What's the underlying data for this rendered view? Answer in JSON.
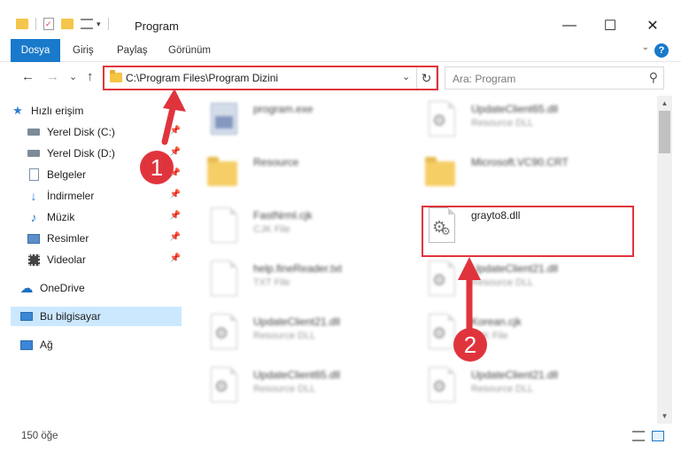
{
  "window": {
    "title": "Program",
    "minimize_glyph": "—",
    "maximize_glyph": "☐",
    "close_glyph": "✕"
  },
  "ribbon": {
    "tabs": [
      "Dosya",
      "Giriş",
      "Paylaş",
      "Görünüm"
    ],
    "help_glyph": "?",
    "collapse_glyph": "⌄"
  },
  "navigation": {
    "back_glyph": "←",
    "forward_glyph": "→",
    "recent_glyph": "⌄",
    "up_glyph": "↑",
    "address": "C:\\Program Files\\Program Dizini",
    "address_dropdown_glyph": "⌄",
    "refresh_glyph": "↻",
    "search_placeholder": "Ara: Program",
    "search_icon_glyph": "⚲"
  },
  "sidebar": {
    "quick_access": "Hızlı erişim",
    "items": [
      {
        "label": "Yerel Disk (C:)",
        "icon": "drive-icon",
        "pinned": true
      },
      {
        "label": "Yerel Disk (D:)",
        "icon": "drive-icon",
        "pinned": true
      },
      {
        "label": "Belgeler",
        "icon": "documents-icon",
        "pinned": true
      },
      {
        "label": "İndirmeler",
        "icon": "downloads-icon",
        "pinned": true
      },
      {
        "label": "Müzik",
        "icon": "music-icon",
        "pinned": true
      },
      {
        "label": "Resimler",
        "icon": "pictures-icon",
        "pinned": true
      },
      {
        "label": "Videolar",
        "icon": "videos-icon",
        "pinned": true
      }
    ],
    "onedrive": "OneDrive",
    "this_pc": "Bu bilgisayar",
    "network": "Ağ"
  },
  "files": {
    "left": [
      {
        "name": "program.exe",
        "type": "",
        "icon": "exe"
      },
      {
        "name": "Resource",
        "type": "",
        "icon": "folder"
      },
      {
        "name": "FastNrml.cjk",
        "type": "CJK File",
        "icon": "doc"
      },
      {
        "name": "help.fineReader.txt",
        "type": "TXT File",
        "icon": "doc"
      },
      {
        "name": "UpdateClient21.dll",
        "type": "Resource DLL",
        "icon": "dll"
      },
      {
        "name": "UpdateClient65.dll",
        "type": "Resource DLL",
        "icon": "dll"
      }
    ],
    "right": [
      {
        "name": "UpdateClient65.dll",
        "type": "Resource DLL",
        "icon": "dll"
      },
      {
        "name": "Microsoft.VC90.CRT",
        "type": "",
        "icon": "folder"
      },
      {
        "name": "grayto8.dll",
        "type": "",
        "icon": "dll"
      },
      {
        "name": "UpdateClient21.dll",
        "type": "Resource DLL",
        "icon": "dll"
      },
      {
        "name": "Korean.cjk",
        "type": "CJK File",
        "icon": "doc"
      },
      {
        "name": "UpdateClient21.dll",
        "type": "Resource DLL",
        "icon": "dll"
      }
    ]
  },
  "status": {
    "item_count": "150 öğe"
  },
  "annotations": {
    "callout_1": "1",
    "callout_2": "2",
    "highlight_color": "#e0343d"
  },
  "colors": {
    "accent": "#1979ca",
    "selection": "#cce8ff",
    "folder": "#f4c64c"
  }
}
